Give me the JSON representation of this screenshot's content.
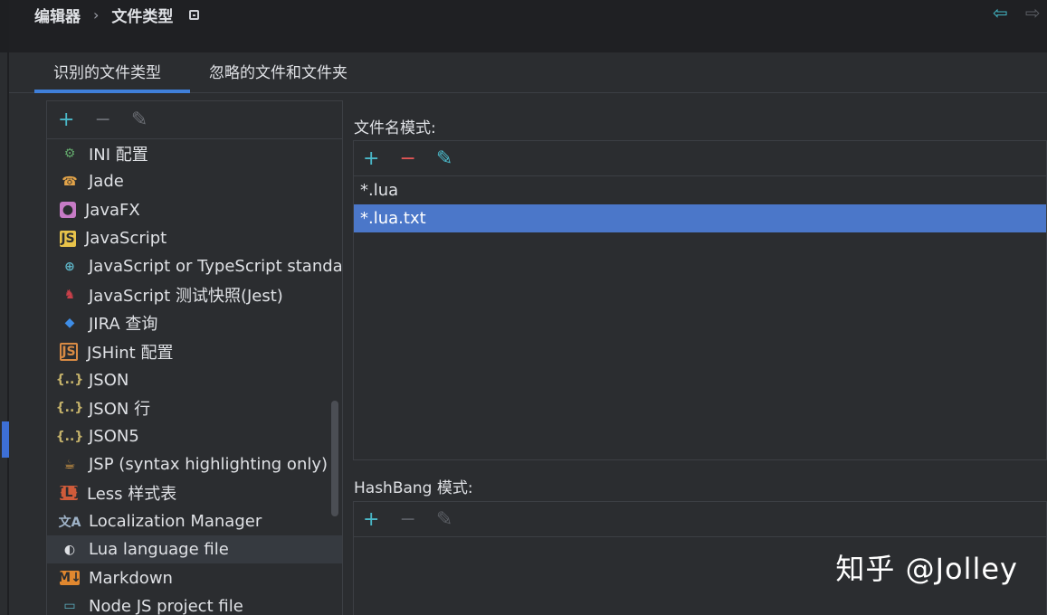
{
  "breadcrumb": {
    "parent": "编辑器",
    "separator": "›",
    "current": "文件类型"
  },
  "nav": {
    "back_icon": "arrow-left-icon",
    "forward_icon": "arrow-right-icon"
  },
  "tabs": [
    {
      "label": "识别的文件类型",
      "active": true
    },
    {
      "label": "忽略的文件和文件夹",
      "active": false
    }
  ],
  "file_types": {
    "toolbar": {
      "add": "+",
      "remove": "−",
      "edit": "✎"
    },
    "items": [
      {
        "label": "INI 配置",
        "icon": "ini-icon",
        "glyph": "⚙"
      },
      {
        "label": "Jade",
        "icon": "jade-icon",
        "glyph": "☎"
      },
      {
        "label": "JavaFX",
        "icon": "javafx-icon",
        "glyph": "●"
      },
      {
        "label": "JavaScript",
        "icon": "javascript-icon",
        "glyph": "JS"
      },
      {
        "label": "JavaScript or TypeScript standa",
        "icon": "globe-icon",
        "glyph": "⊕"
      },
      {
        "label": "JavaScript 测试快照(Jest)",
        "icon": "jest-icon",
        "glyph": "♞"
      },
      {
        "label": "JIRA 查询",
        "icon": "jira-icon",
        "glyph": "◆"
      },
      {
        "label": "JSHint 配置",
        "icon": "jshint-icon",
        "glyph": "JS"
      },
      {
        "label": "JSON",
        "icon": "json-icon",
        "glyph": "{..}"
      },
      {
        "label": "JSON 行",
        "icon": "json-lines-icon",
        "glyph": "{..}"
      },
      {
        "label": "JSON5",
        "icon": "json5-icon",
        "glyph": "{..}"
      },
      {
        "label": "JSP (syntax highlighting only)",
        "icon": "jsp-icon",
        "glyph": "☕"
      },
      {
        "label": "Less 样式表",
        "icon": "less-icon",
        "glyph": "{L}"
      },
      {
        "label": "Localization Manager",
        "icon": "translate-icon",
        "glyph": "文A"
      },
      {
        "label": "Lua language file",
        "icon": "lua-icon",
        "glyph": "◐",
        "selected": true
      },
      {
        "label": "Markdown",
        "icon": "markdown-icon",
        "glyph": "M↓"
      },
      {
        "label": "Node JS project file",
        "icon": "node-project-icon",
        "glyph": "▭"
      }
    ]
  },
  "filename_patterns": {
    "label": "文件名模式:",
    "toolbar": {
      "add": "+",
      "remove": "−",
      "edit": "✎"
    },
    "items": [
      {
        "value": "*.lua",
        "selected": false
      },
      {
        "value": "*.lua.txt",
        "selected": true
      }
    ]
  },
  "hashbang_patterns": {
    "label": "HashBang 模式:",
    "toolbar": {
      "add": "+",
      "remove": "−",
      "edit": "✎"
    }
  },
  "watermark": "知乎 @Jolley",
  "colors": {
    "accent": "#3f7fd9",
    "selection": "#4b77c9",
    "add": "#4ab8c8",
    "remove": "#e35656"
  }
}
